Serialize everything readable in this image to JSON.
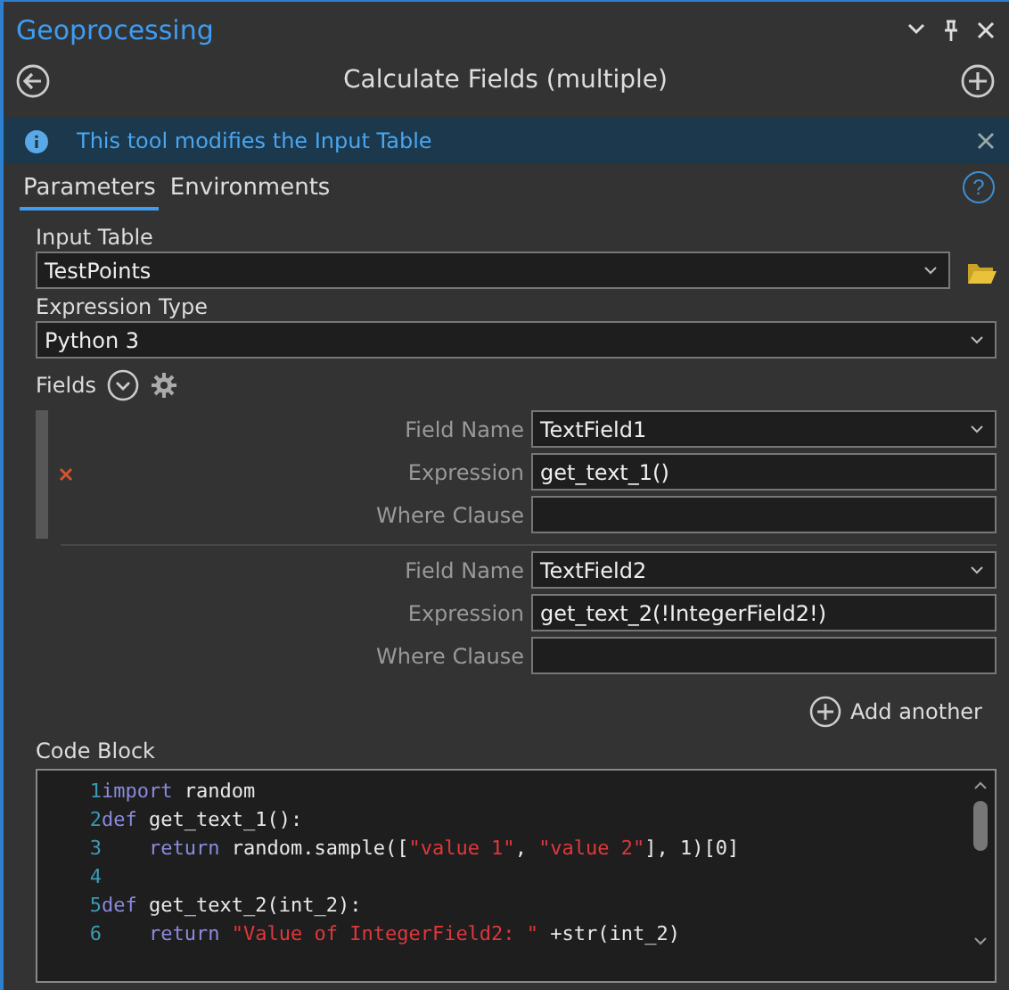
{
  "pane": {
    "title": "Geoprocessing"
  },
  "tool": {
    "title": "Calculate Fields (multiple)"
  },
  "banner": {
    "message": "This tool modifies the Input Table"
  },
  "tabs": [
    {
      "label": "Parameters",
      "selected": true
    },
    {
      "label": "Environments",
      "selected": false
    }
  ],
  "help": {
    "label": "?"
  },
  "input_table": {
    "label": "Input Table",
    "value": "TestPoints"
  },
  "expression_type": {
    "label": "Expression Type",
    "value": "Python 3"
  },
  "fields": {
    "label": "Fields",
    "groups": [
      {
        "selected": true,
        "rows": [
          {
            "kind": "dropdown",
            "label": "Field Name",
            "value": "TextField1"
          },
          {
            "kind": "text",
            "label": "Expression",
            "value": "get_text_1()"
          },
          {
            "kind": "text",
            "label": "Where Clause"
          }
        ]
      },
      {
        "selected": false,
        "rows": [
          {
            "kind": "dropdown",
            "label": "Field Name",
            "value": "TextField2"
          },
          {
            "kind": "text",
            "label": "Expression",
            "value": "get_text_2(!IntegerField2!)"
          },
          {
            "kind": "text",
            "label": "Where Clause"
          }
        ]
      }
    ],
    "add_label": "Add another"
  },
  "code_block": {
    "label": "Code Block",
    "lines": [
      {
        "number": "1",
        "tokens": [
          {
            "kind": "keyword",
            "text": "import"
          },
          {
            "kind": "plain",
            "text": " random"
          }
        ]
      },
      {
        "number": "2",
        "tokens": [
          {
            "kind": "keyword",
            "text": "def"
          },
          {
            "kind": "plain",
            "text": " get_text_1():"
          }
        ]
      },
      {
        "number": "3",
        "tokens": [
          {
            "kind": "keyword",
            "text": "    return"
          },
          {
            "kind": "plain",
            "text": " random.sample(["
          },
          {
            "kind": "string",
            "text": "\"value 1\""
          },
          {
            "kind": "plain",
            "text": ", "
          },
          {
            "kind": "string",
            "text": "\"value 2\""
          },
          {
            "kind": "plain",
            "text": "], 1)[0]"
          }
        ]
      },
      {
        "number": "4"
      },
      {
        "number": "5",
        "tokens": [
          {
            "kind": "keyword",
            "text": "def"
          },
          {
            "kind": "plain",
            "text": " get_text_2(int_2):"
          }
        ]
      },
      {
        "number": "6",
        "tokens": [
          {
            "kind": "keyword",
            "text": "    return "
          },
          {
            "kind": "string",
            "text": "\"Value of IntegerField2: \""
          },
          {
            "kind": "plain",
            "text": " +str(int_2)"
          }
        ]
      }
    ]
  }
}
